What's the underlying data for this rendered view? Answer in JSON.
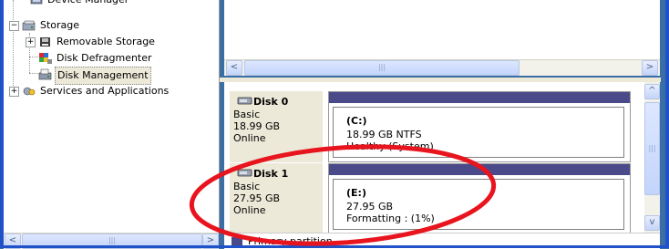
{
  "tree": {
    "items": [
      {
        "label": "Device Manager",
        "selected": false
      },
      {
        "label": "Storage",
        "selected": false
      },
      {
        "label": "Removable Storage",
        "selected": false
      },
      {
        "label": "Disk Defragmenter",
        "selected": false
      },
      {
        "label": "Disk Management",
        "selected": true
      },
      {
        "label": "Services and Applications",
        "selected": false
      }
    ],
    "expanders": {
      "storage": "−",
      "removable": "+",
      "services": "+"
    }
  },
  "scroll": {
    "thumb_grip": "|||",
    "left_arrow": "<",
    "right_arrow": ">",
    "up_arrow": "^",
    "down_arrow": "v"
  },
  "disks": [
    {
      "name": "Disk 0",
      "type": "Basic",
      "size": "18.99 GB",
      "status": "Online",
      "volume": {
        "letter": "(C:)",
        "detail": "18.99 GB NTFS",
        "health": "Healthy (System)"
      }
    },
    {
      "name": "Disk 1",
      "type": "Basic",
      "size": "27.95 GB",
      "status": "Online",
      "volume": {
        "letter": "(E:)",
        "detail": "27.95 GB",
        "health": "Formatting : (1%)"
      }
    }
  ],
  "legend": {
    "label": "Primary partition",
    "color": "#4a4a8a"
  },
  "annotation": {
    "color": "#e8141e"
  }
}
